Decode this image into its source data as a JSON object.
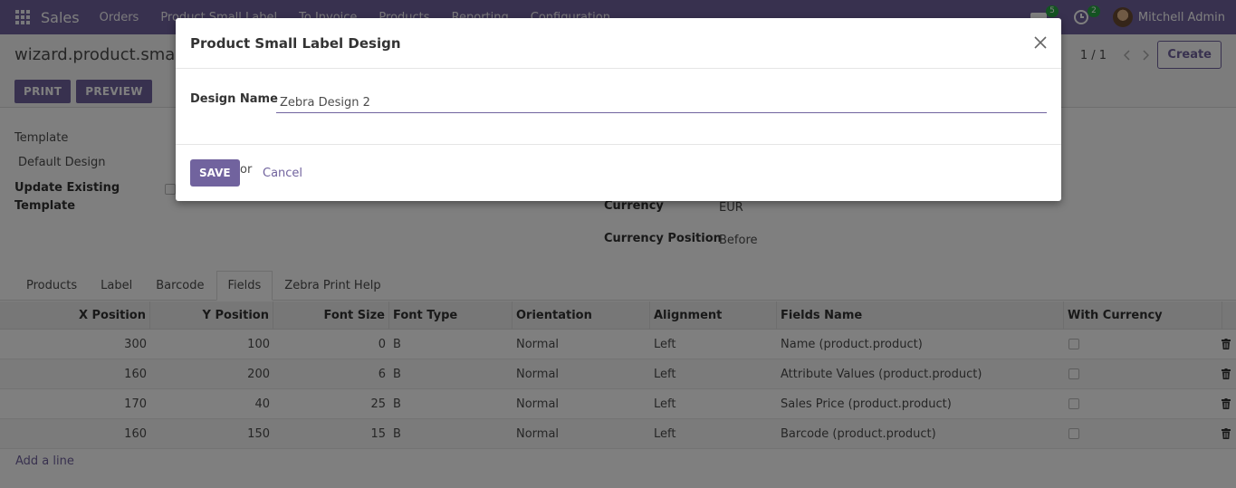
{
  "navbar": {
    "app_name": "Sales",
    "menu": [
      "Orders",
      "Product Small Label",
      "To Invoice",
      "Products",
      "Reporting",
      "Configuration"
    ],
    "messages_badge": "5",
    "activities_badge": "2",
    "user_name": "Mitchell Admin"
  },
  "control_panel": {
    "title": "wizard.product.small.l",
    "pager": "1 / 1",
    "create_label": "Create",
    "print_label": "PRINT",
    "preview_label": "PREVIEW"
  },
  "form": {
    "template_label": "Template",
    "template_value": "Default Design",
    "update_existing_label_1": "Update Existing",
    "update_existing_label_2": "Template",
    "currency_label": "Currency",
    "currency_value": "EUR",
    "currency_position_label": "Currency Position",
    "currency_position_value": "Before"
  },
  "tabs": [
    "Products",
    "Label",
    "Barcode",
    "Fields",
    "Zebra Print Help"
  ],
  "active_tab": "Fields",
  "table": {
    "headers": [
      "X Position",
      "Y Position",
      "Font Size",
      "Font Type",
      "Orientation",
      "Alignment",
      "Fields Name",
      "With Currency"
    ],
    "rows": [
      {
        "x": "300",
        "y": "100",
        "size": "0",
        "type": "B",
        "orientation": "Normal",
        "alignment": "Left",
        "field": "Name (product.product)"
      },
      {
        "x": "160",
        "y": "200",
        "size": "6",
        "type": "B",
        "orientation": "Normal",
        "alignment": "Left",
        "field": "Attribute Values (product.product)"
      },
      {
        "x": "170",
        "y": "40",
        "size": "25",
        "type": "B",
        "orientation": "Normal",
        "alignment": "Left",
        "field": "Sales Price (product.product)"
      },
      {
        "x": "160",
        "y": "150",
        "size": "15",
        "type": "B",
        "orientation": "Normal",
        "alignment": "Left",
        "field": "Barcode (product.product)"
      }
    ],
    "add_line": "Add a line"
  },
  "modal": {
    "title": "Product Small Label Design",
    "design_name_label": "Design Name",
    "design_name_value": "Zebra Design 2",
    "save_label": "SAVE",
    "or_text": "or",
    "cancel_label": "Cancel"
  },
  "colors": {
    "brand": "#71639e",
    "badge": "#28a745"
  }
}
